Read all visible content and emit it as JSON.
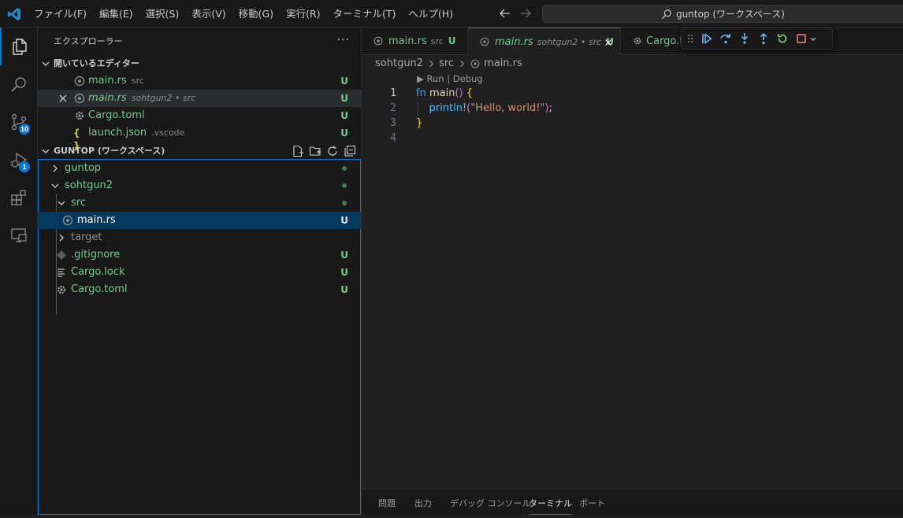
{
  "menu": [
    "ファイル(F)",
    "編集(E)",
    "選択(S)",
    "表示(V)",
    "移動(G)",
    "実行(R)",
    "ターミナル(T)",
    "ヘルプ(H)"
  ],
  "command_center": "guntop (ワークスペース)",
  "activity_bar": {
    "source_control_badge": "10",
    "run_debug_badge": "1"
  },
  "sidebar": {
    "title": "エクスプローラー",
    "more": "···",
    "open_editors": {
      "header": "開いているエディター",
      "items": [
        {
          "name": "main.rs",
          "desc": "src",
          "status": "U"
        },
        {
          "name": "main.rs",
          "desc": "sohtgun2 • src",
          "status": "U"
        },
        {
          "name": "Cargo.toml",
          "desc": "",
          "status": "U"
        },
        {
          "name": "launch.json",
          "desc": ".vscode",
          "status": "U"
        }
      ]
    },
    "workspace": {
      "header": "GUNTOP (ワークスペース)",
      "tree": [
        {
          "name": "guntop"
        },
        {
          "name": "sohtgun2"
        },
        {
          "name": "src"
        },
        {
          "name": "main.rs",
          "status": "U"
        },
        {
          "name": "target"
        },
        {
          "name": ".gitignore",
          "status": "U"
        },
        {
          "name": "Cargo.lock",
          "status": "U"
        },
        {
          "name": "Cargo.toml",
          "status": "U"
        }
      ]
    }
  },
  "tabs": [
    {
      "name": "main.rs",
      "desc": "src",
      "status": "U"
    },
    {
      "name": "main.rs",
      "desc": "sohtgun2 • src",
      "status": "U"
    },
    {
      "name": "Cargo.to"
    }
  ],
  "breadcrumb": [
    "sohtgun2",
    "src",
    "main.rs"
  ],
  "codelens": "▶ Run | Debug",
  "code": {
    "line_numbers": [
      "1",
      "2",
      "3",
      "4"
    ],
    "fn_kw": "fn",
    "fn_name": "main",
    "parens": "()",
    "open_brace": "{",
    "macro": "println!",
    "paren_open": "(",
    "string": "\"Hello, world!\"",
    "paren_close": ")",
    "semi": ";",
    "close_brace": "}"
  },
  "panel_tabs": [
    "問題",
    "出力",
    "デバッグ コンソール",
    "ターミナル",
    "ポート"
  ]
}
